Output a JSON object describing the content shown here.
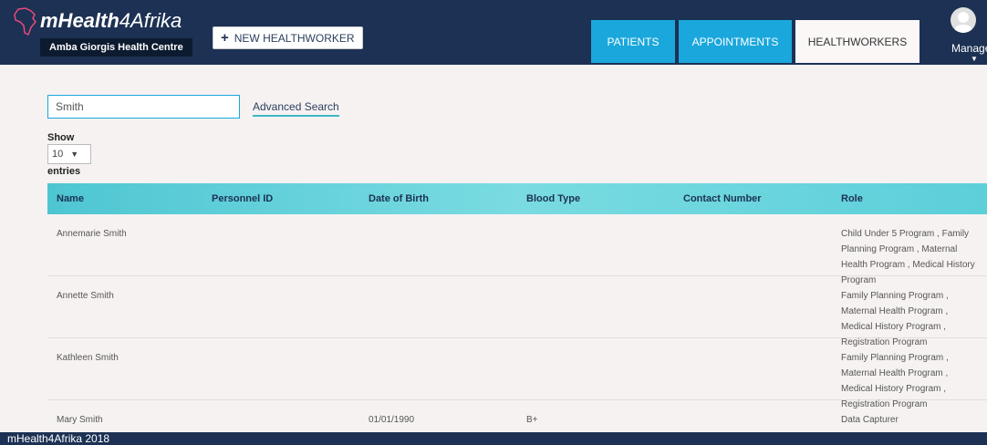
{
  "brand": {
    "name_bold": "mHealth",
    "name_light": "4Afrika",
    "clinic": "Amba Giorgis Health Centre"
  },
  "toolbar": {
    "new_label": "NEW HEALTHWORKER"
  },
  "nav": {
    "patients": "PATIENTS",
    "appointments": "APPOINTMENTS",
    "healthworkers": "HEALTHWORKERS"
  },
  "user": {
    "manage_label": "Manage"
  },
  "search": {
    "value": "Smith",
    "advanced_label": "Advanced Search"
  },
  "paging": {
    "show_label": "Show",
    "page_size": "10",
    "entries_label": "entries"
  },
  "table": {
    "headers": [
      "Name",
      "Personnel ID",
      "Date of Birth",
      "Blood Type",
      "Contact Number",
      "Role"
    ],
    "rows": [
      [
        "Annemarie Smith",
        "",
        "",
        "",
        "",
        "Child Under 5 Program , Family Planning Program , Maternal Health Program , Medical History Program"
      ],
      [
        "Annette Smith",
        "",
        "",
        "",
        "",
        "Family Planning Program , Maternal Health Program , Medical History Program , Registration Program"
      ],
      [
        "Kathleen Smith",
        "",
        "",
        "",
        "",
        "Family Planning Program , Maternal Health Program , Medical History Program , Registration Program"
      ],
      [
        "Mary Smith",
        "",
        "01/01/1990",
        "B+",
        "",
        "Data Capturer"
      ]
    ]
  },
  "footer": {
    "text": "mHealth4Afrika 2018"
  },
  "colors": {
    "topbar": "#1c3153",
    "nav_active": "#1aa7dc",
    "header_teal": "#4ec6d2"
  }
}
